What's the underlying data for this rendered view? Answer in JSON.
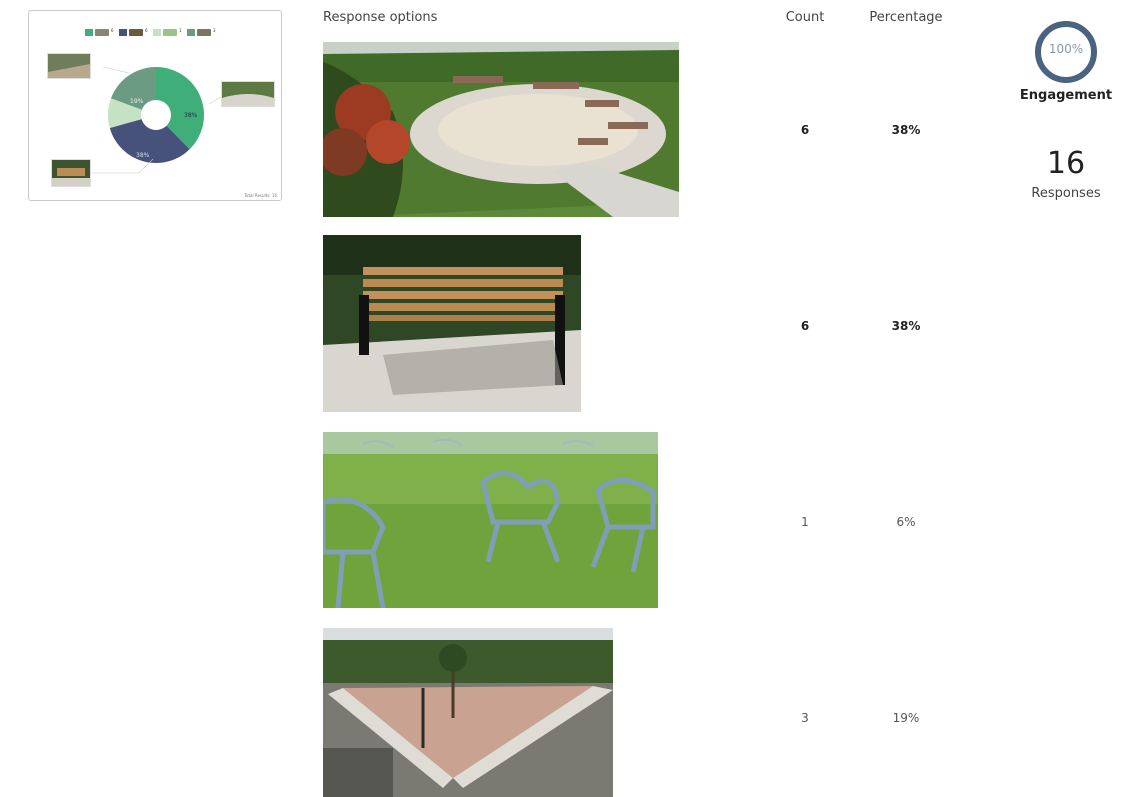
{
  "thumbnail": {
    "total_label": "Total Results: 16",
    "slice_labels": [
      "38%",
      "38%",
      "19%"
    ],
    "legend_counts": [
      "6",
      "6",
      "1",
      "3"
    ],
    "colors": [
      "#3fae79",
      "#46527a",
      "#c5e2c5",
      "#6b9c83"
    ]
  },
  "table": {
    "headers": {
      "options": "Response options",
      "count": "Count",
      "percentage": "Percentage"
    },
    "rows": [
      {
        "image": "circular-plaza-with-curved-benches",
        "count": "6",
        "percentage": "38%",
        "bold": true
      },
      {
        "image": "wooden-park-bench",
        "count": "6",
        "percentage": "38%",
        "bold": true
      },
      {
        "image": "blue-chairs-on-lawn",
        "count": "1",
        "percentage": "6%",
        "bold": false
      },
      {
        "image": "triangular-plaza-with-step-seating",
        "count": "3",
        "percentage": "19%",
        "bold": false
      }
    ]
  },
  "stats": {
    "engagement_value": "100%",
    "engagement_fraction": 1.0,
    "engagement_label": "Engagement",
    "responses_value": "16",
    "responses_label": "Responses"
  },
  "colors": {
    "gauge_ring": "#4a6380",
    "gauge_bg": "#e6ebf0"
  }
}
